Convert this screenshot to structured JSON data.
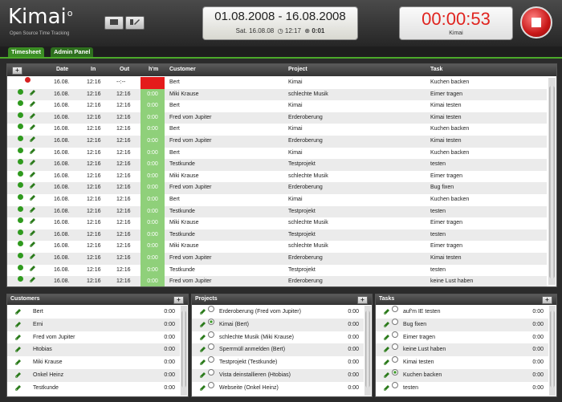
{
  "app": {
    "name": "Kimai",
    "tagline": "Open Source Time Tracking"
  },
  "header": {
    "date_range": "01.08.2008 - 16.08.2008",
    "today": "Sat. 16.08.08",
    "clock": "12:17",
    "total": "0:01",
    "timer": "00:00:53",
    "timer_label": "Kimai"
  },
  "tabs": [
    {
      "label": "Timesheet"
    },
    {
      "label": "Admin Panel"
    }
  ],
  "timesheet": {
    "columns": {
      "date": "Date",
      "in": "In",
      "out": "Out",
      "hm": "h'm",
      "customer": "Customer",
      "project": "Project",
      "task": "Task"
    },
    "rows": [
      {
        "date": "16.08.",
        "in": "12:16",
        "out": "--:--",
        "hm": "",
        "customer": "Bert",
        "project": "Kimai",
        "task": "Kuchen backen",
        "running": true
      },
      {
        "date": "16.08.",
        "in": "12:16",
        "out": "12:16",
        "hm": "0:00",
        "customer": "Miki Krause",
        "project": "schlechte Musik",
        "task": "Eimer tragen"
      },
      {
        "date": "16.08.",
        "in": "12:16",
        "out": "12:16",
        "hm": "0:00",
        "customer": "Bert",
        "project": "Kimai",
        "task": "Kimai testen"
      },
      {
        "date": "16.08.",
        "in": "12:16",
        "out": "12:16",
        "hm": "0:00",
        "customer": "Fred vom Jupiter",
        "project": "Erderoberung",
        "task": "Kimai testen"
      },
      {
        "date": "16.08.",
        "in": "12:16",
        "out": "12:16",
        "hm": "0:00",
        "customer": "Bert",
        "project": "Kimai",
        "task": "Kuchen backen"
      },
      {
        "date": "16.08.",
        "in": "12:16",
        "out": "12:16",
        "hm": "0:00",
        "customer": "Fred vom Jupiter",
        "project": "Erderoberung",
        "task": "Kimai testen"
      },
      {
        "date": "16.08.",
        "in": "12:16",
        "out": "12:16",
        "hm": "0:00",
        "customer": "Bert",
        "project": "Kimai",
        "task": "Kuchen backen"
      },
      {
        "date": "16.08.",
        "in": "12:16",
        "out": "12:16",
        "hm": "0:00",
        "customer": "Testkunde",
        "project": "Testprojekt",
        "task": "testen"
      },
      {
        "date": "16.08.",
        "in": "12:16",
        "out": "12:16",
        "hm": "0:00",
        "customer": "Miki Krause",
        "project": "schlechte Musik",
        "task": "Eimer tragen"
      },
      {
        "date": "16.08.",
        "in": "12:16",
        "out": "12:16",
        "hm": "0:00",
        "customer": "Fred vom Jupiter",
        "project": "Erderoberung",
        "task": "Bug fixen"
      },
      {
        "date": "16.08.",
        "in": "12:16",
        "out": "12:16",
        "hm": "0:00",
        "customer": "Bert",
        "project": "Kimai",
        "task": "Kuchen backen"
      },
      {
        "date": "16.08.",
        "in": "12:16",
        "out": "12:16",
        "hm": "0:00",
        "customer": "Testkunde",
        "project": "Testprojekt",
        "task": "testen"
      },
      {
        "date": "16.08.",
        "in": "12:16",
        "out": "12:16",
        "hm": "0:00",
        "customer": "Miki Krause",
        "project": "schlechte Musik",
        "task": "Eimer tragen"
      },
      {
        "date": "16.08.",
        "in": "12:16",
        "out": "12:16",
        "hm": "0:00",
        "customer": "Testkunde",
        "project": "Testprojekt",
        "task": "testen"
      },
      {
        "date": "16.08.",
        "in": "12:16",
        "out": "12:16",
        "hm": "0:00",
        "customer": "Miki Krause",
        "project": "schlechte Musik",
        "task": "Eimer tragen"
      },
      {
        "date": "16.08.",
        "in": "12:16",
        "out": "12:16",
        "hm": "0:00",
        "customer": "Fred vom Jupiter",
        "project": "Erderoberung",
        "task": "Kimai testen"
      },
      {
        "date": "16.08.",
        "in": "12:16",
        "out": "12:16",
        "hm": "0:00",
        "customer": "Testkunde",
        "project": "Testprojekt",
        "task": "testen"
      },
      {
        "date": "16.08.",
        "in": "12:16",
        "out": "12:16",
        "hm": "0:00",
        "customer": "Fred vom Jupiter",
        "project": "Erderoberung",
        "task": "keine Lust haben"
      }
    ]
  },
  "customers": {
    "title": "Customers",
    "items": [
      {
        "name": "Bert",
        "time": "0:00"
      },
      {
        "name": "Erni",
        "time": "0:00"
      },
      {
        "name": "Fred vom Jupiter",
        "time": "0:00"
      },
      {
        "name": "Htobias",
        "time": "0:00"
      },
      {
        "name": "Miki Krause",
        "time": "0:00"
      },
      {
        "name": "Onkel Heinz",
        "time": "0:00"
      },
      {
        "name": "Testkunde",
        "time": "0:00"
      }
    ]
  },
  "projects": {
    "title": "Projects",
    "items": [
      {
        "name": "Erderoberung (Fred vom Jupiter)",
        "time": "0:00",
        "selected": false
      },
      {
        "name": "Kimai (Bert)",
        "time": "0:00",
        "selected": true
      },
      {
        "name": "schlechte Musik (Miki Krause)",
        "time": "0:00",
        "selected": false
      },
      {
        "name": "Sperrmüll anmelden (Bert)",
        "time": "0:00",
        "selected": false
      },
      {
        "name": "Testprojekt (Testkunde)",
        "time": "0:00",
        "selected": false
      },
      {
        "name": "Vista deinstallieren (Htobias)",
        "time": "0:00",
        "selected": false
      },
      {
        "name": "Webseite (Onkel Heinz)",
        "time": "0:00",
        "selected": false
      }
    ]
  },
  "tasks": {
    "title": "Tasks",
    "items": [
      {
        "name": "auf'm IE testen",
        "time": "0:00",
        "selected": false
      },
      {
        "name": "Bug fixen",
        "time": "0:00",
        "selected": false
      },
      {
        "name": "Eimer tragen",
        "time": "0:00",
        "selected": false
      },
      {
        "name": "keine Lust haben",
        "time": "0:00",
        "selected": false
      },
      {
        "name": "Kimai testen",
        "time": "0:00",
        "selected": false
      },
      {
        "name": "Kuchen backen",
        "time": "0:00",
        "selected": true
      },
      {
        "name": "testen",
        "time": "0:00",
        "selected": false
      }
    ]
  },
  "colors": {
    "accent": "#3b8d24",
    "running": "#e41b1b",
    "duration": "#8fd07a",
    "timer": "#e0241f"
  }
}
